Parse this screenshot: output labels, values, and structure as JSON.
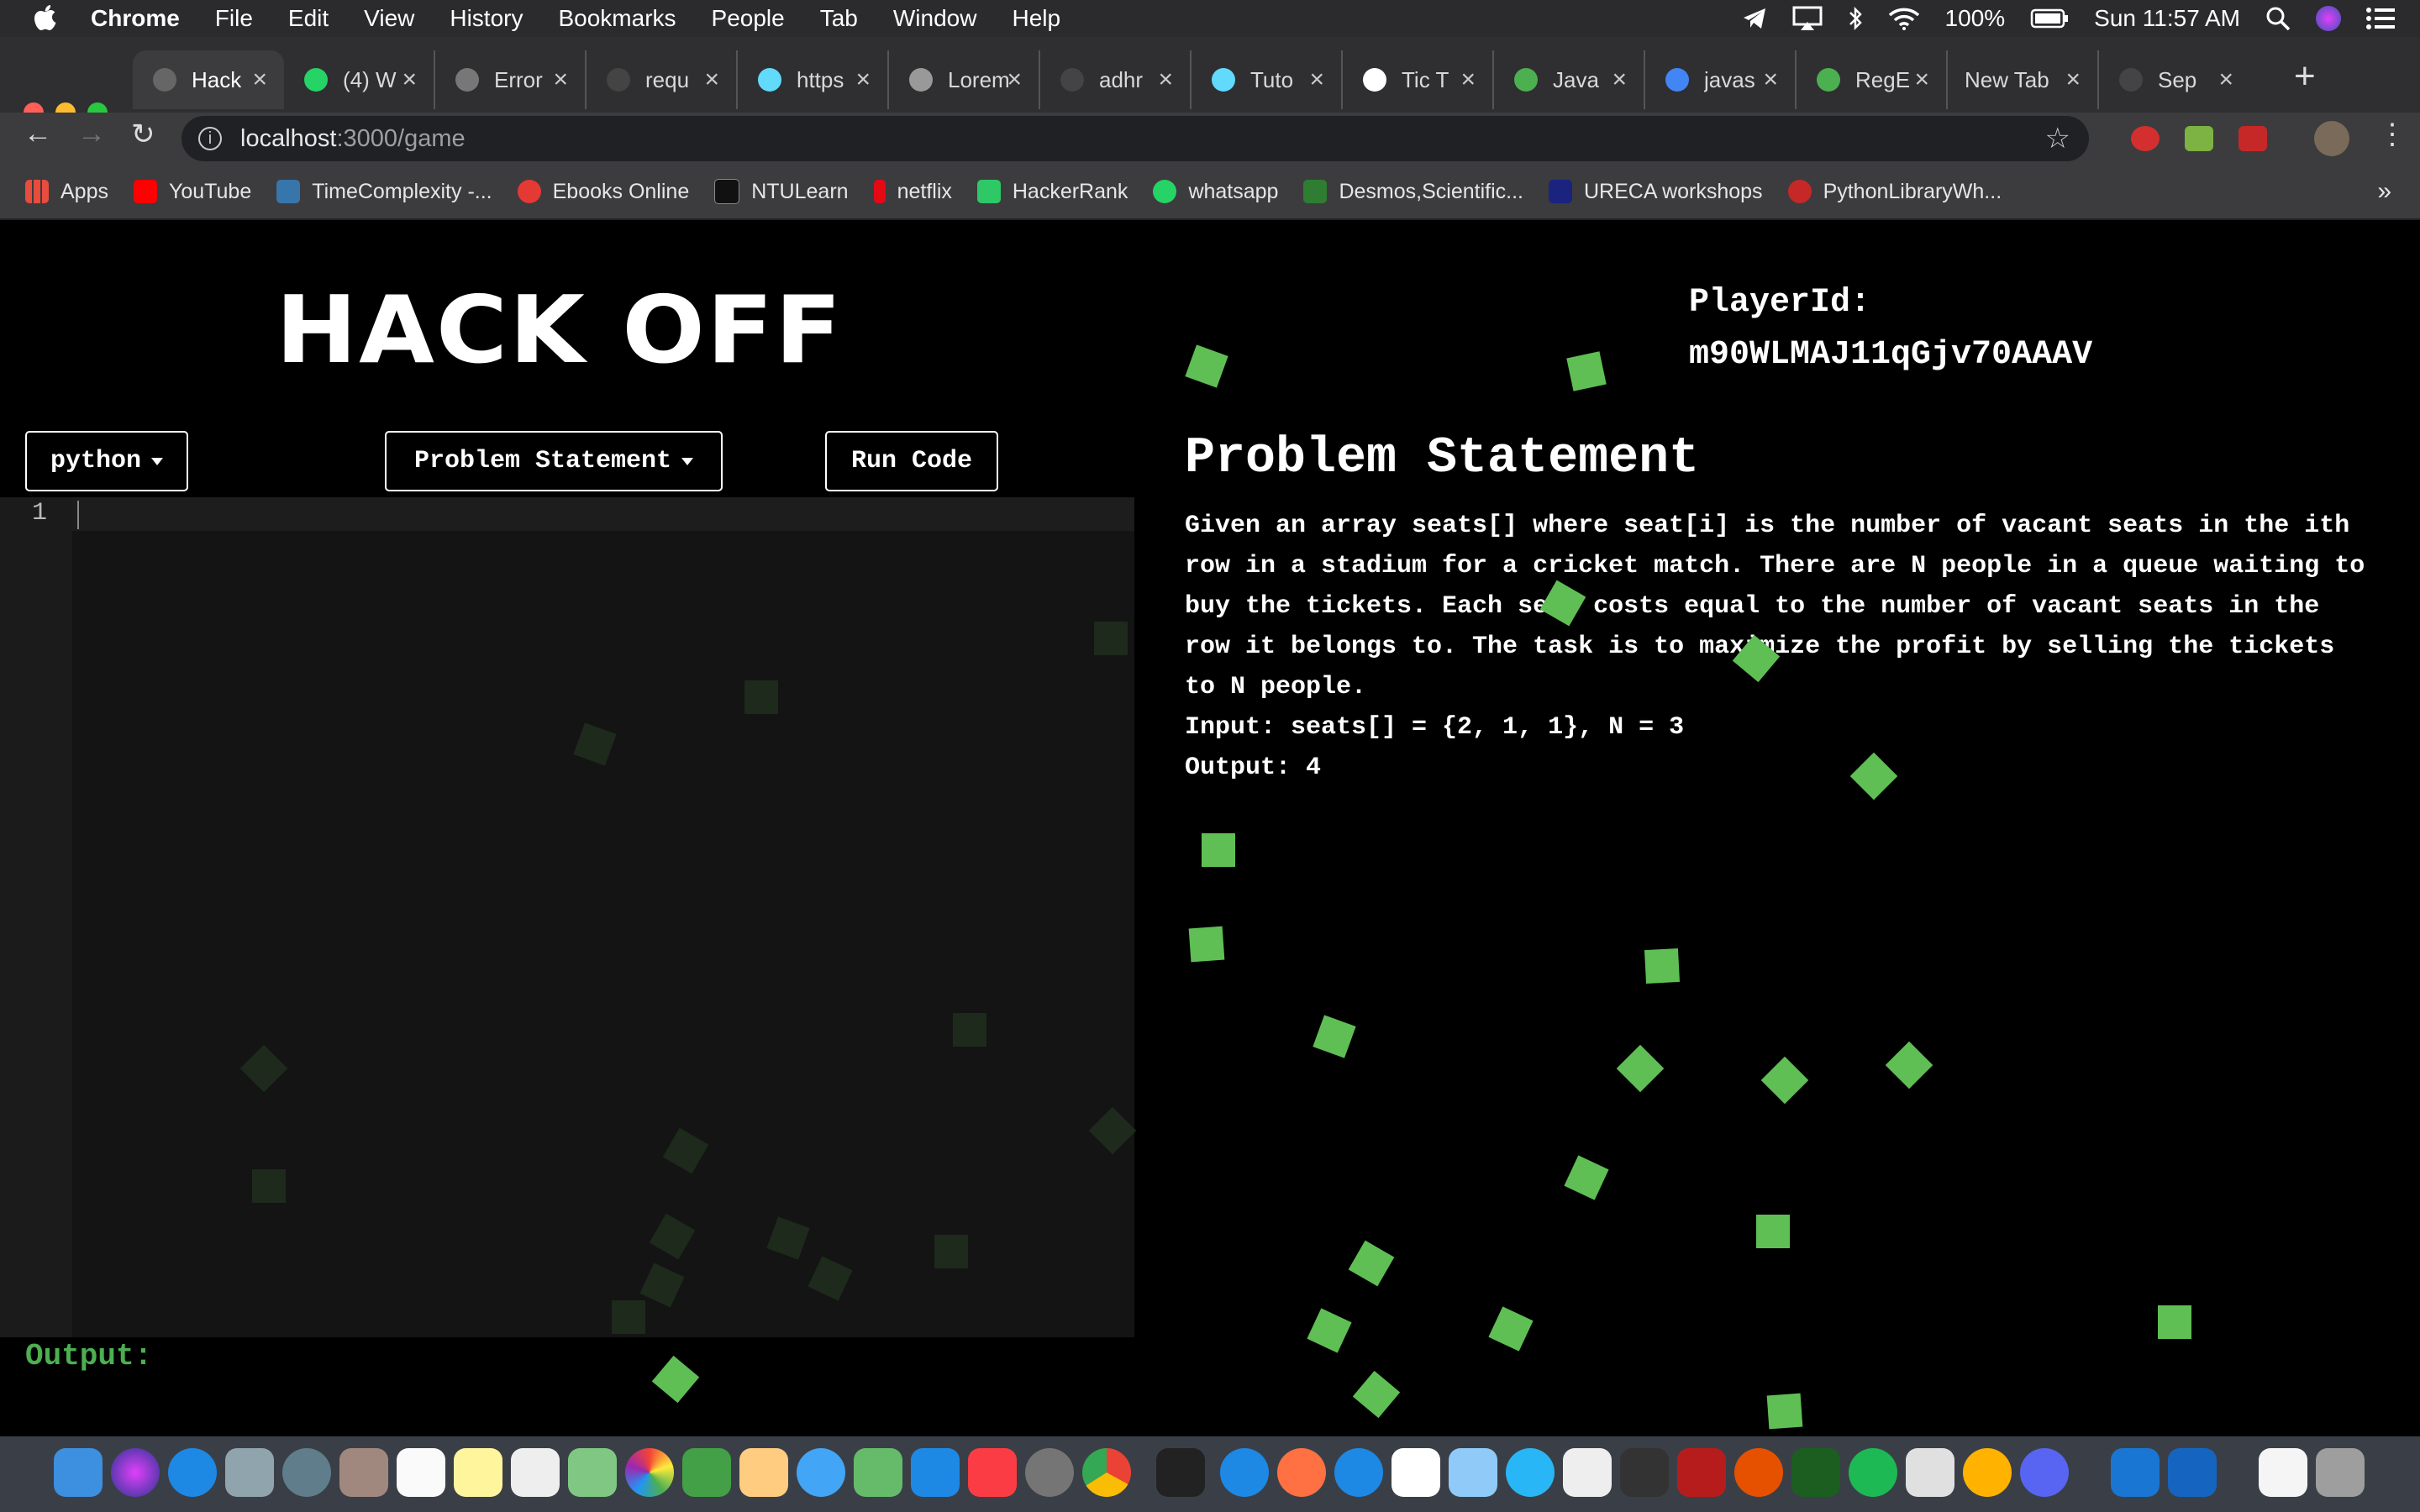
{
  "menubar": {
    "app": "Chrome",
    "items": [
      "File",
      "Edit",
      "View",
      "History",
      "Bookmarks",
      "People",
      "Tab",
      "Window",
      "Help"
    ],
    "battery": "100%",
    "clock": "Sun 11:57 AM"
  },
  "tabs": [
    {
      "label": "Hack",
      "color": "#666"
    },
    {
      "label": "(4) W",
      "color": "#25d366"
    },
    {
      "label": "Error",
      "color": "#777"
    },
    {
      "label": "requ",
      "color": "#444"
    },
    {
      "label": "https",
      "color": "#61dafb"
    },
    {
      "label": "Lorem",
      "color": "#999"
    },
    {
      "label": "adhr",
      "color": "#444"
    },
    {
      "label": "Tuto",
      "color": "#61dafb"
    },
    {
      "label": "Tic T",
      "color": "#fff"
    },
    {
      "label": "Java",
      "color": "#4caf50"
    },
    {
      "label": "javas",
      "color": "#4285f4"
    },
    {
      "label": "RegE",
      "color": "#4caf50"
    },
    {
      "label": "New Tab",
      "color": ""
    },
    {
      "label": "Sep",
      "color": "#444"
    }
  ],
  "address": {
    "host": "localhost",
    "path": ":3000/game"
  },
  "bookmarks": [
    {
      "label": "Apps",
      "color": "#e74c3c"
    },
    {
      "label": "YouTube",
      "color": "#ff0000"
    },
    {
      "label": "TimeComplexity -...",
      "color": "#3776ab"
    },
    {
      "label": "Ebooks Online",
      "color": "#e53935"
    },
    {
      "label": "NTULearn",
      "color": "#111"
    },
    {
      "label": "netflix",
      "color": "#e50914"
    },
    {
      "label": "HackerRank",
      "color": "#2ec866"
    },
    {
      "label": "whatsapp",
      "color": "#25d366"
    },
    {
      "label": "Desmos,Scientific...",
      "color": "#2e7d32"
    },
    {
      "label": "URECA workshops",
      "color": "#1a237e"
    },
    {
      "label": "PythonLibraryWh...",
      "color": "#c62828"
    }
  ],
  "page": {
    "logo": "HACK OFF",
    "player_label": "PlayerId:",
    "player_id": "m90WLMAJ11qGjv70AAAV",
    "language": "python",
    "problem_menu": "Problem Statement",
    "run_button": "Run Code",
    "line_number": "1",
    "output_label": "Output:",
    "problem_title": "Problem Statement",
    "problem_text": "Given an array seats[] where seat[i] is the number of vacant seats in the ith row in a stadium for a cricket match. There are N people in a queue waiting to buy the tickets. Each seat costs equal to the number of vacant seats in the row it belongs to. The task is to maximize the profit by selling the tickets to N people.",
    "problem_input": "Input: seats[] = {2, 1, 1}, N = 3",
    "problem_output": "Output: 4",
    "accent_color": "#5fbf55"
  }
}
